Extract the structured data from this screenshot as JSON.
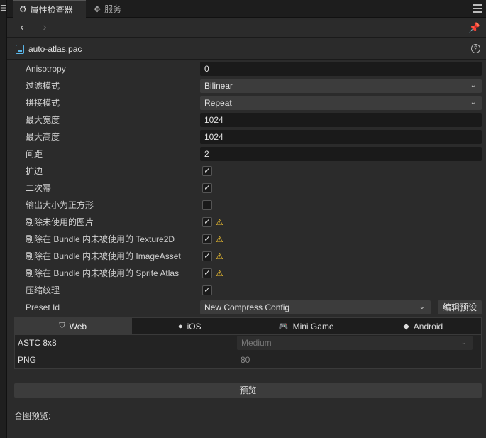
{
  "tabs": [
    {
      "label": "属性检查器",
      "icon": "inspector-icon",
      "active": true
    },
    {
      "label": "服务",
      "icon": "services-icon",
      "active": false
    }
  ],
  "file": {
    "name": "auto-atlas.pac",
    "icon": "image-file-icon"
  },
  "properties": {
    "anisotropy": {
      "label": "Anisotropy",
      "value": "0"
    },
    "filter_mode": {
      "label": "过滤模式",
      "value": "Bilinear"
    },
    "wrap_mode": {
      "label": "拼接模式",
      "value": "Repeat"
    },
    "max_width": {
      "label": "最大宽度",
      "value": "1024"
    },
    "max_height": {
      "label": "最大高度",
      "value": "1024"
    },
    "padding": {
      "label": "间距",
      "value": "2"
    },
    "extrude": {
      "label": "扩边",
      "checked": true
    },
    "power_of_two": {
      "label": "二次幂",
      "checked": true
    },
    "force_square": {
      "label": "输出大小为正方形",
      "checked": false
    },
    "remove_unused_images": {
      "label": "剔除未使用的图片",
      "checked": true,
      "warning": true
    },
    "remove_unused_texture2d": {
      "label": "剔除在 Bundle 内未被使用的 Texture2D",
      "checked": true,
      "warning": true
    },
    "remove_unused_imageasset": {
      "label": "剔除在 Bundle 内未被使用的 ImageAsset",
      "checked": true,
      "warning": true
    },
    "remove_unused_sprite_atlas": {
      "label": "剔除在 Bundle 内未被使用的 Sprite Atlas",
      "checked": true,
      "warning": true
    },
    "compress_texture": {
      "label": "压缩纹理",
      "checked": true
    },
    "preset_id": {
      "label": "Preset Id",
      "value": "New Compress Config",
      "edit_button": "编辑预设"
    }
  },
  "platform_tabs": [
    {
      "label": "Web",
      "icon": "html5-icon",
      "active": true
    },
    {
      "label": "iOS",
      "icon": "apple-icon",
      "active": false
    },
    {
      "label": "Mini Game",
      "icon": "gamepad-icon",
      "active": false
    },
    {
      "label": "Android",
      "icon": "android-icon",
      "active": false
    }
  ],
  "platform_rows": {
    "astc": {
      "label": "ASTC 8x8",
      "value": "Medium"
    },
    "png": {
      "label": "PNG",
      "value": "80"
    }
  },
  "preview_button": "预览",
  "merge_preview_label": "合图预览:",
  "colors": {
    "background": "#2b2b2b",
    "field": "#1a1a1a",
    "warning": "#f2c230",
    "file_icon": "#5ab4e6"
  }
}
